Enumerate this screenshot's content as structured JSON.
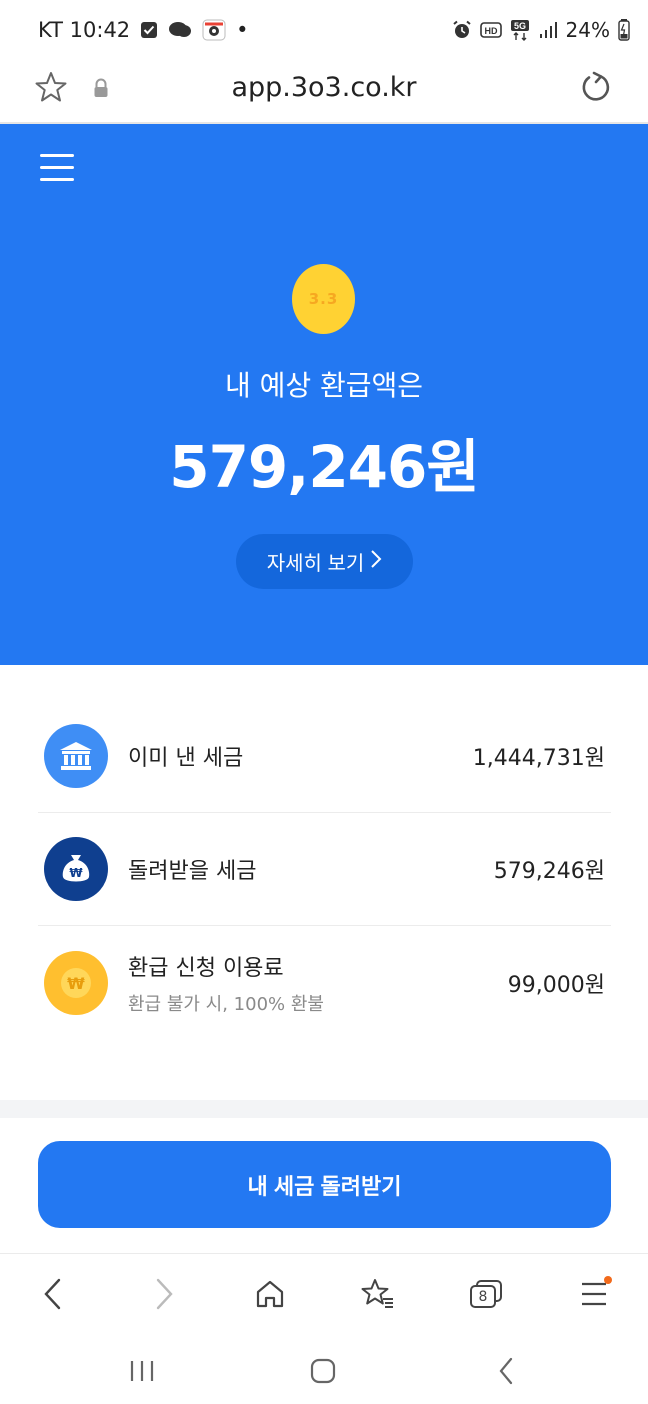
{
  "status_bar": {
    "carrier_time": "KT 10:42",
    "dot": "•",
    "battery": "24%",
    "icons": [
      "checkbox-icon",
      "chat-icon",
      "maps-icon",
      "alarm-icon",
      "hd-icon",
      "5g-icon",
      "signal-icon",
      "battery-icon"
    ]
  },
  "url_bar": {
    "url": "app.3o3.co.kr"
  },
  "hero": {
    "coin_label": "3.3",
    "subtitle": "내 예상 환급액은",
    "amount": "579,246원",
    "detail_button": "자세히 보기"
  },
  "breakdown": [
    {
      "label": "이미 낸 세금",
      "sub": "",
      "value": "1,444,731원",
      "icon": "bank-icon",
      "color": "#3f8ef5"
    },
    {
      "label": "돌려받을 세금",
      "sub": "",
      "value": "579,246원",
      "icon": "money-bag-icon",
      "color": "#0f3f8f"
    },
    {
      "label": "환급 신청 이용료",
      "sub": "환급 불가 시, 100% 환불",
      "value": "99,000원",
      "icon": "won-coin-icon",
      "color": "#ffbf2f"
    }
  ],
  "cta": {
    "label": "내 세금 돌려받기"
  },
  "toolbar": {
    "tab_count": "8"
  },
  "colors": {
    "brand_blue": "#2378f2",
    "button_blue_dark": "#1467dc",
    "coin_yellow": "#ffd233"
  }
}
